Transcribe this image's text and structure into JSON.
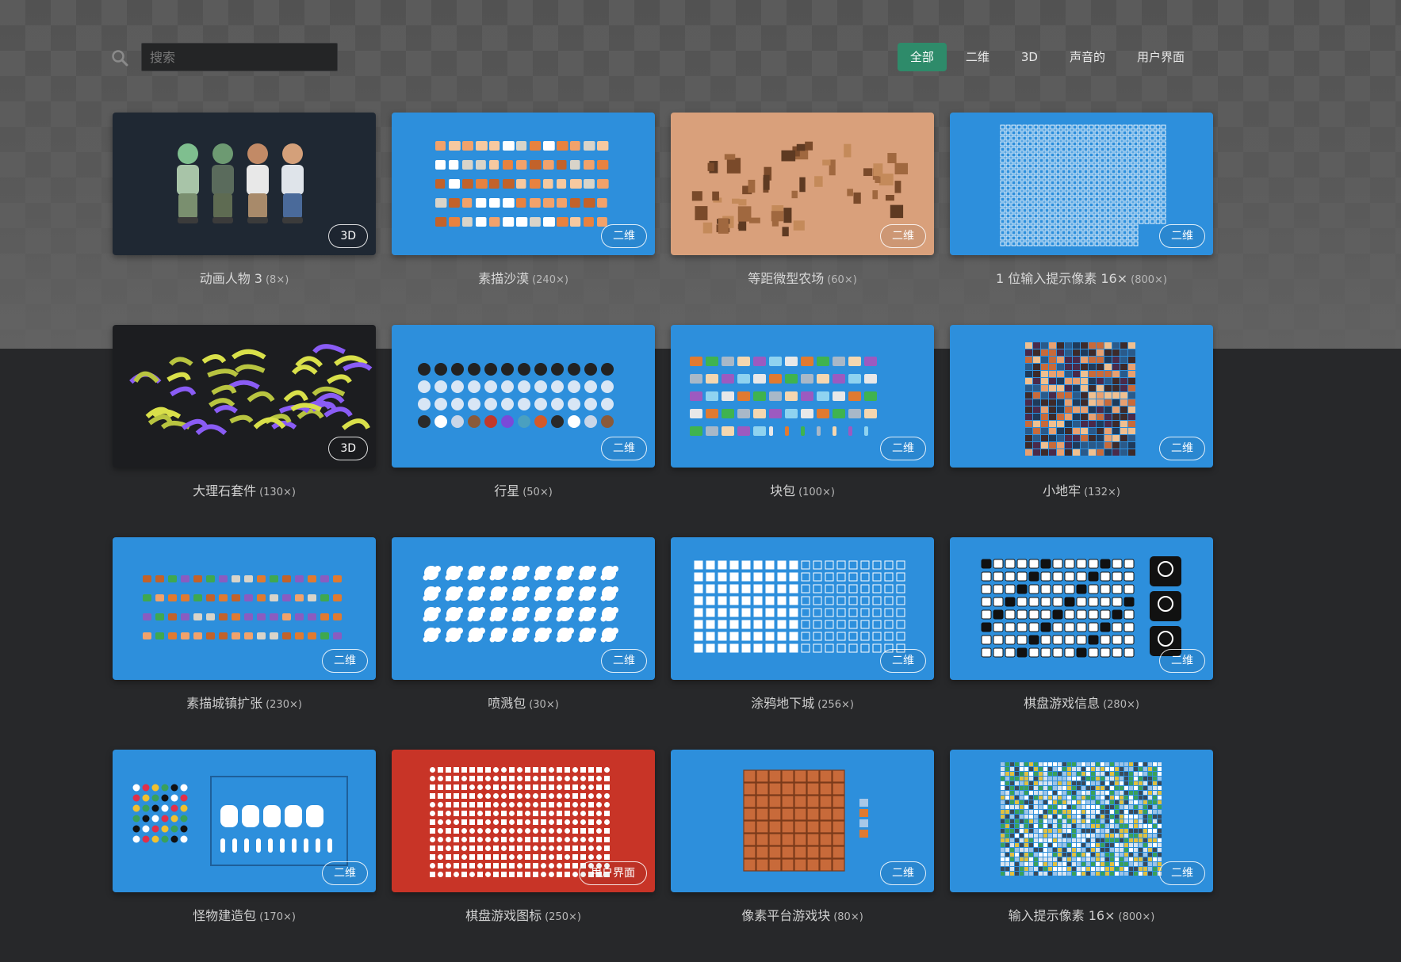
{
  "search": {
    "placeholder": "搜索"
  },
  "filters": [
    {
      "label": "全部",
      "active": true
    },
    {
      "label": "二维",
      "active": false
    },
    {
      "label": "3D",
      "active": false
    },
    {
      "label": "声音的",
      "active": false
    },
    {
      "label": "用户界面",
      "active": false
    }
  ],
  "colors": {
    "accent": "#2e8b6a",
    "card_blue": "#2d8fdc",
    "card_red": "#c83427",
    "card_tan": "#d9a07b",
    "card_dark": "#1f2833"
  },
  "packs": [
    {
      "title": "动画人物 3",
      "count": "(8×)",
      "badge": "3D",
      "thumb": "characters"
    },
    {
      "title": "素描沙漠",
      "count": "(240×)",
      "badge": "二维",
      "thumb": "desert"
    },
    {
      "title": "等距微型农场",
      "count": "(60×)",
      "badge": "二维",
      "thumb": "farm"
    },
    {
      "title": "1 位输入提示像素 16×",
      "count": "(800×)",
      "badge": "二维",
      "thumb": "pixelgrid"
    },
    {
      "title": "大理石套件",
      "count": "(130×)",
      "badge": "3D",
      "thumb": "marble"
    },
    {
      "title": "行星",
      "count": "(50×)",
      "badge": "二维",
      "thumb": "planets"
    },
    {
      "title": "块包",
      "count": "(100×)",
      "badge": "二维",
      "thumb": "blocks"
    },
    {
      "title": "小地牢",
      "count": "(132×)",
      "badge": "二维",
      "thumb": "dungeon"
    },
    {
      "title": "素描城镇扩张",
      "count": "(230×)",
      "badge": "二维",
      "thumb": "town"
    },
    {
      "title": "喷溅包",
      "count": "(30×)",
      "badge": "二维",
      "thumb": "splat"
    },
    {
      "title": "涂鸦地下城",
      "count": "(256×)",
      "badge": "二维",
      "thumb": "doodle"
    },
    {
      "title": "棋盘游戏信息",
      "count": "(280×)",
      "badge": "二维",
      "thumb": "boardinfo"
    },
    {
      "title": "怪物建造包",
      "count": "(170×)",
      "badge": "二维",
      "thumb": "monster"
    },
    {
      "title": "棋盘游戏图标",
      "count": "(250×)",
      "badge": "用户界面",
      "thumb": "boardicons"
    },
    {
      "title": "像素平台游戏块",
      "count": "(80×)",
      "badge": "二维",
      "thumb": "platformer"
    },
    {
      "title": "输入提示像素 16×",
      "count": "(800×)",
      "badge": "二维",
      "thumb": "inputprompts"
    }
  ]
}
